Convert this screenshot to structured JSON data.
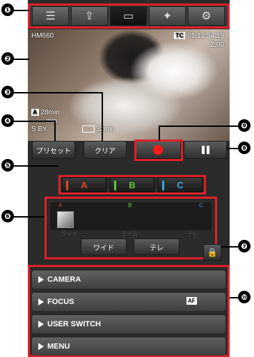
{
  "tabs": [
    {
      "icon": "clip-list-edit-icon",
      "glyph": "☰"
    },
    {
      "icon": "clip-upload-icon",
      "glyph": "⇪"
    },
    {
      "icon": "monitor-icon",
      "glyph": "▭"
    },
    {
      "icon": "camera-settings-icon",
      "glyph": "✦"
    },
    {
      "icon": "gear-icon",
      "glyph": "⚙"
    }
  ],
  "video": {
    "model": "HM660",
    "timecode_badge": "TC",
    "timecode": "01:12:54.19",
    "zoom": "Z:00",
    "slot_a_label": "A",
    "slot_a_time": "28min",
    "slot_b_time": "min",
    "status": "S  BY",
    "battery_time": "32min"
  },
  "controls": {
    "preset_label": "プリセット",
    "clear_label": "クリア"
  },
  "presets": [
    {
      "label": "A",
      "color": "#e0462a"
    },
    {
      "label": "B",
      "color": "#5ec83a"
    },
    {
      "label": "C",
      "color": "#3aa3e0"
    }
  ],
  "zoom_marks": {
    "a": "A",
    "b": "B",
    "c": "C"
  },
  "zoom_scale": {
    "wide": "ワイド",
    "zoom": "ズーム",
    "tele": "テレ"
  },
  "zoom_buttons": {
    "wide": "ワイド",
    "tele": "テレ"
  },
  "menu": [
    {
      "label": "CAMERA"
    },
    {
      "label": "FOCUS",
      "badge": "AF"
    },
    {
      "label": "USER SWITCH"
    },
    {
      "label": "MENU"
    }
  ],
  "callouts": [
    "❶",
    "❷",
    "❸",
    "❹",
    "❺",
    "❻",
    "❼",
    "❽",
    "❾",
    "❿"
  ]
}
